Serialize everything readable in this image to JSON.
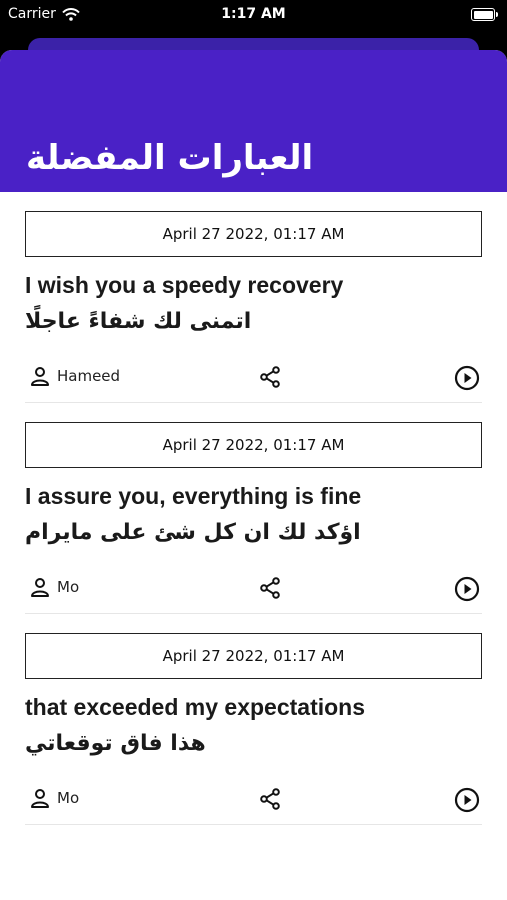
{
  "status_bar": {
    "carrier": "Carrier",
    "time": "1:17 AM"
  },
  "header": {
    "title": "العبارات المفضلة"
  },
  "phrases": [
    {
      "date": "April 27 2022, 01:17 AM",
      "english": "I wish you a speedy recovery",
      "arabic": "اتمنى لك شفاءً عاجلًا",
      "author": "Hameed"
    },
    {
      "date": "April 27 2022, 01:17 AM",
      "english": "I assure you, everything is fine",
      "arabic": "اؤكد لك ان كل شئ على مايرام",
      "author": "Mo"
    },
    {
      "date": "April 27 2022, 01:17 AM",
      "english": "that exceeded my expectations",
      "arabic": "هذا فاق توقعاتي",
      "author": "Mo"
    }
  ],
  "icons": {
    "wifi": "wifi-icon",
    "battery": "battery-icon",
    "user": "user-icon",
    "share": "share-icon",
    "play": "play-icon"
  },
  "colors": {
    "header": "#4a21c6",
    "status_bg": "#000000"
  }
}
